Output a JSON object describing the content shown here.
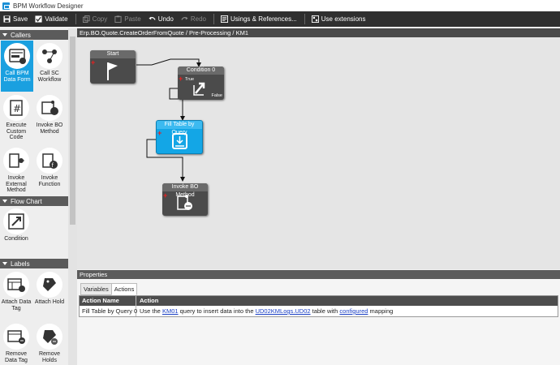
{
  "window": {
    "title": "BPM Workflow Designer"
  },
  "toolbar": {
    "save": "Save",
    "validate": "Validate",
    "copy": "Copy",
    "paste": "Paste",
    "undo": "Undo",
    "redo": "Redo",
    "usings": "Usings & References...",
    "extensions": "Use extensions"
  },
  "sidebar": {
    "callers": {
      "label": "Callers",
      "items": [
        {
          "label": "Call BPM Data Form",
          "icon": "form-icon"
        },
        {
          "label": "Call SC Workflow",
          "icon": "workflow-icon"
        },
        {
          "label": "Execute Custom Code",
          "icon": "code-icon"
        },
        {
          "label": "Invoke BO Method",
          "icon": "method-icon"
        },
        {
          "label": "Invoke External Method",
          "icon": "external-icon"
        },
        {
          "label": "Invoke Function",
          "icon": "function-icon"
        }
      ]
    },
    "flowchart": {
      "label": "Flow Chart",
      "items": [
        {
          "label": "Condition",
          "icon": "condition-icon"
        }
      ]
    },
    "labels": {
      "label": "Labels",
      "items": [
        {
          "label": "Attach Data Tag",
          "icon": "tag-icon"
        },
        {
          "label": "Attach Hold",
          "icon": "hold-icon"
        },
        {
          "label": "Remove Data Tag",
          "icon": "remove-tag-icon"
        },
        {
          "label": "Remove Holds",
          "icon": "remove-hold-icon"
        }
      ]
    }
  },
  "breadcrumb": "Erp.BO.Quote.CreateOrderFromQuote / Pre-Processing / KM1",
  "canvas": {
    "nodes": {
      "start": {
        "label": "Start"
      },
      "condition": {
        "label": "Condition 0",
        "true_label": "True",
        "false_label": "False"
      },
      "fill": {
        "label": "Fill Table by Query"
      },
      "invoke": {
        "label": "Invoke BO Method"
      }
    }
  },
  "properties": {
    "title": "Properties",
    "tabs": [
      "Variables",
      "Actions"
    ],
    "active_tab": "Actions",
    "columns": [
      "Action Name",
      "Action"
    ],
    "rows": [
      {
        "name": "Fill Table by Query 0",
        "action": {
          "p1": "Use the ",
          "l1": "KM01",
          "p2": " query to insert data into the ",
          "l2": "UD02KMLogs.UD02",
          "p3": " table with ",
          "l3": "configured",
          "p4": " mapping"
        }
      }
    ]
  },
  "colors": {
    "accent": "#1aa0e0",
    "toolbar": "#2f2f2f",
    "node_dark": "#4b4b4b"
  }
}
